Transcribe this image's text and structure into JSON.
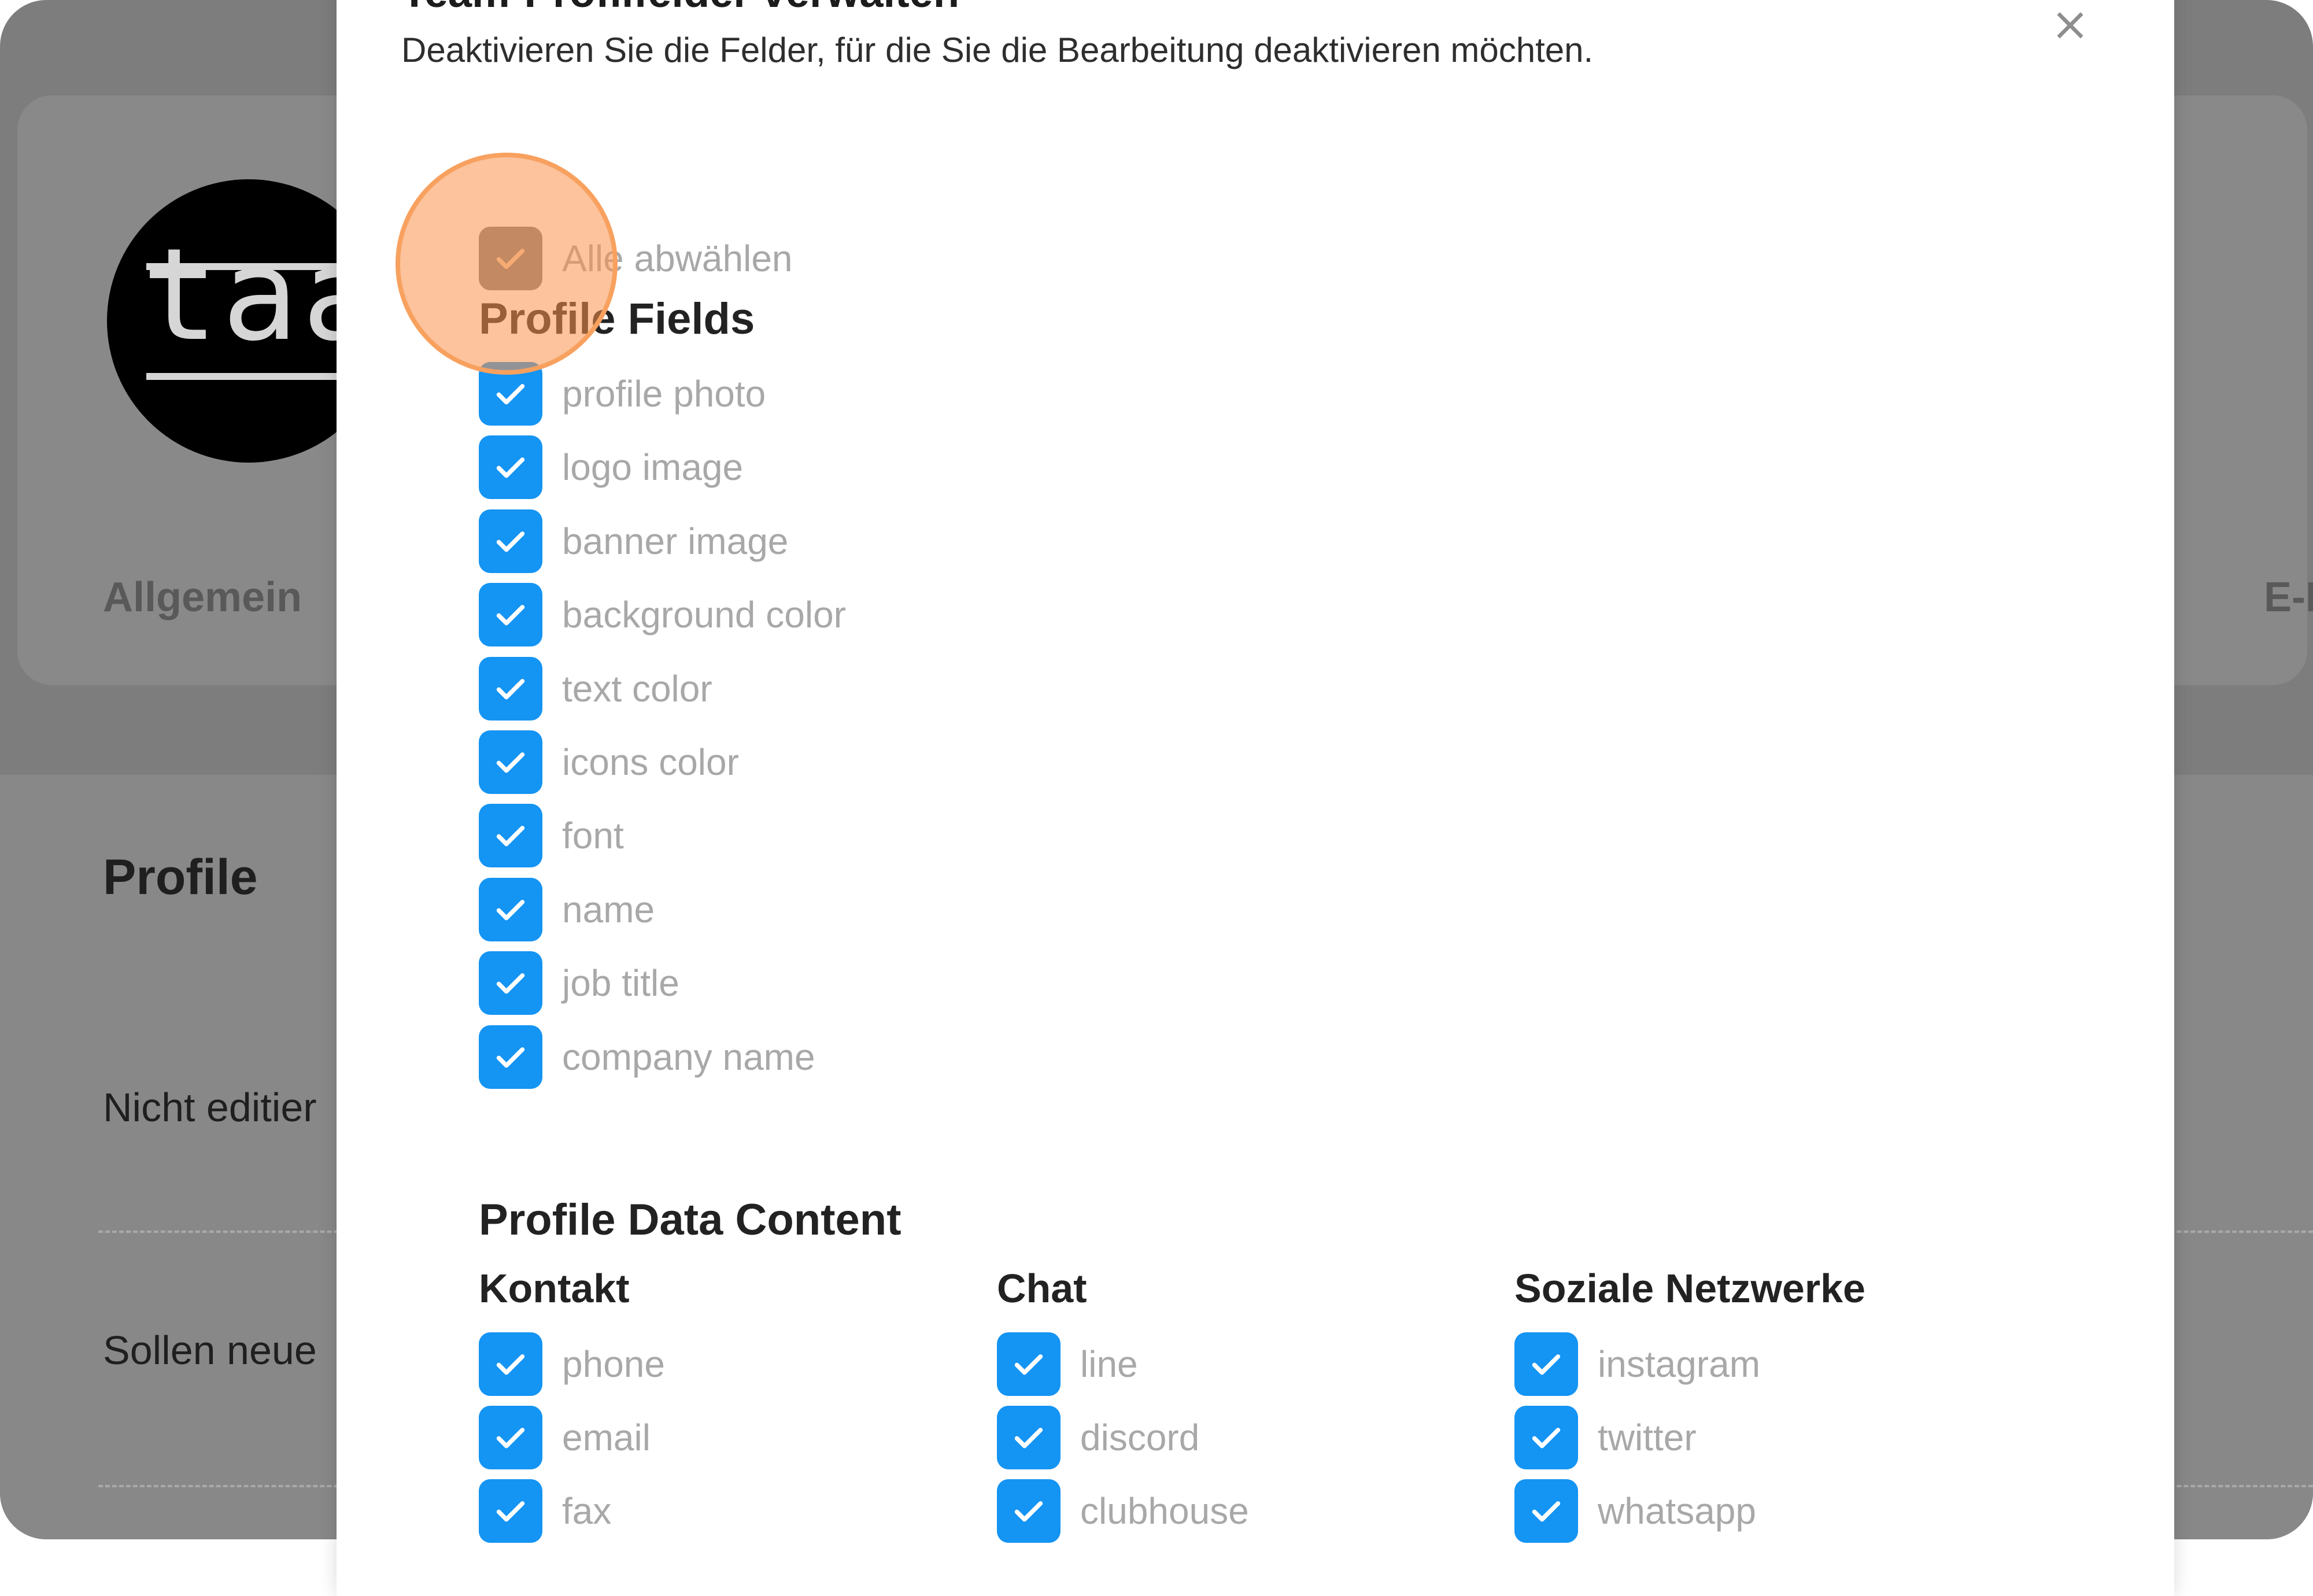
{
  "background": {
    "logo_text": "taac",
    "tab_left": "Allgemein",
    "tab_right": "E-M",
    "heading": "Profile",
    "row1": "Nicht editier",
    "row2": "Sollen neue"
  },
  "modal": {
    "title": "Team-Profilfelder verwalten",
    "description": "Deaktivieren Sie die Felder, für die Sie die Bearbeitung deaktivieren möchten.",
    "close_icon": "×",
    "select_all_label": "Alle abwählen",
    "profile_fields_title": "Profile Fields",
    "profile_fields": [
      {
        "label": "profile photo",
        "checked": true
      },
      {
        "label": "logo image",
        "checked": true
      },
      {
        "label": "banner image",
        "checked": true
      },
      {
        "label": "background color",
        "checked": true
      },
      {
        "label": "text color",
        "checked": true
      },
      {
        "label": "icons color",
        "checked": true
      },
      {
        "label": "font",
        "checked": true
      },
      {
        "label": "name",
        "checked": true
      },
      {
        "label": "job title",
        "checked": true
      },
      {
        "label": "company name",
        "checked": true
      }
    ],
    "data_content_title": "Profile Data Content",
    "columns": [
      {
        "title": "Kontakt",
        "items": [
          "phone",
          "email",
          "fax"
        ]
      },
      {
        "title": "Chat",
        "items": [
          "line",
          "discord",
          "clubhouse"
        ]
      },
      {
        "title": "Soziale Netzwerke",
        "items": [
          "instagram",
          "twitter",
          "whatsapp"
        ]
      }
    ]
  },
  "colors": {
    "checkbox": "#1494f3",
    "checkbox_disabled": "#7e7e7e",
    "highlight": "#f9924a"
  }
}
